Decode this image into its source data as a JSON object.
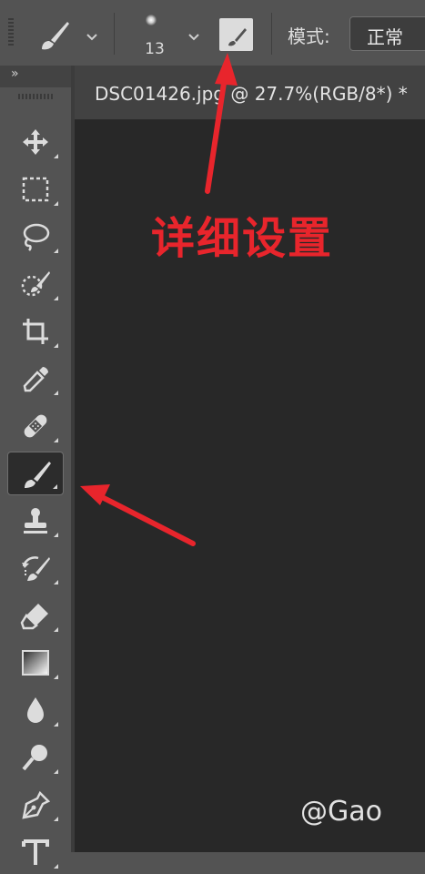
{
  "options_bar": {
    "brush_size": "13",
    "mode_label": "模式:",
    "mode_value": "正常"
  },
  "tools_panel": {
    "collapse_label": "»",
    "tools": [
      {
        "name": "move-tool",
        "icon": "move-icon"
      },
      {
        "name": "marquee-tool",
        "icon": "rect-marquee-icon"
      },
      {
        "name": "lasso-tool",
        "icon": "lasso-icon"
      },
      {
        "name": "quick-selection-tool",
        "icon": "quick-select-icon"
      },
      {
        "name": "crop-tool",
        "icon": "crop-icon"
      },
      {
        "name": "eyedropper-tool",
        "icon": "eyedropper-icon"
      },
      {
        "name": "healing-brush-tool",
        "icon": "bandage-icon"
      },
      {
        "name": "brush-tool",
        "icon": "brush-icon",
        "active": true
      },
      {
        "name": "clone-stamp-tool",
        "icon": "stamp-icon"
      },
      {
        "name": "history-brush-tool",
        "icon": "history-brush-icon"
      },
      {
        "name": "eraser-tool",
        "icon": "eraser-icon"
      },
      {
        "name": "gradient-tool",
        "icon": "gradient-icon"
      },
      {
        "name": "blur-tool",
        "icon": "drop-icon"
      },
      {
        "name": "dodge-tool",
        "icon": "dodge-icon"
      },
      {
        "name": "pen-tool",
        "icon": "pen-nib-icon"
      },
      {
        "name": "type-tool",
        "icon": "type-icon"
      }
    ]
  },
  "document": {
    "tab_title": "DSC01426.jpg @ 27.7%(RGB/8*) *"
  },
  "annotation": {
    "text": "详细设置",
    "color": "#e8252c"
  },
  "watermark": "@Gao",
  "colors": {
    "ui_gray": "#535353",
    "canvas": "#282828",
    "arrow_red": "#e8252c"
  }
}
